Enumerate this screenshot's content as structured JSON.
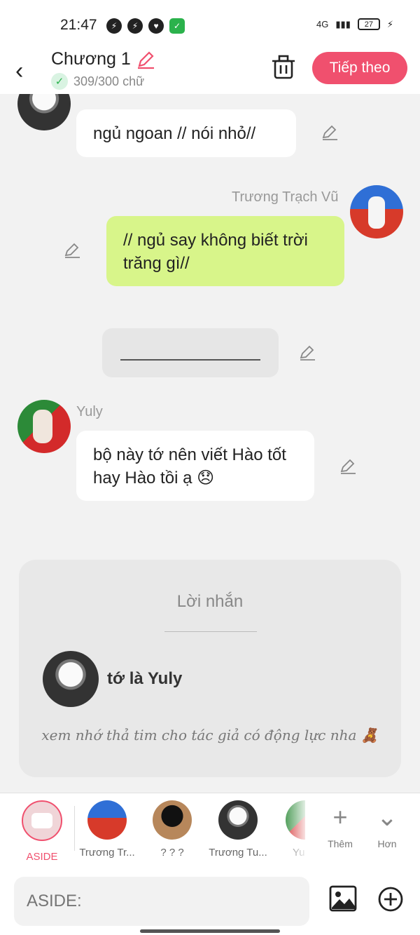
{
  "status_bar": {
    "time": "21:47",
    "network": "4G",
    "battery": "27",
    "icons": [
      "messenger-icon",
      "messenger-icon",
      "heart-monitor-icon",
      "shield-icon"
    ]
  },
  "header": {
    "title": "Chương 1",
    "word_count": "309/300 chữ",
    "next_label": "Tiếp theo"
  },
  "messages": [
    {
      "text": "ngủ ngoan // nói nhỏ//"
    },
    {
      "sender": "Trương Trạch Vũ",
      "text": "// ngủ say không biết trời trăng gì//"
    },
    {
      "sender": "Yuly",
      "text": "bộ này tớ nên viết Hào tốt hay Hào tồi ạ 😞"
    }
  ],
  "note_card": {
    "title": "Lời nhắn",
    "author": "tớ là Yuly",
    "message": "xem nhớ thả tim cho tác giả có động lực nha 🧸"
  },
  "characters": [
    {
      "label": "ASIDE"
    },
    {
      "label": "Trương Tr..."
    },
    {
      "label": "? ? ?"
    },
    {
      "label": "Trương Tu..."
    },
    {
      "label": "Yu"
    }
  ],
  "tools": {
    "add_label": "Thêm",
    "more_label": "Hơn"
  },
  "input": {
    "placeholder": "ASIDE:"
  },
  "colors": {
    "accent": "#f0506e",
    "green_bubble": "#d8f58a",
    "check_green": "#2bb24c"
  }
}
